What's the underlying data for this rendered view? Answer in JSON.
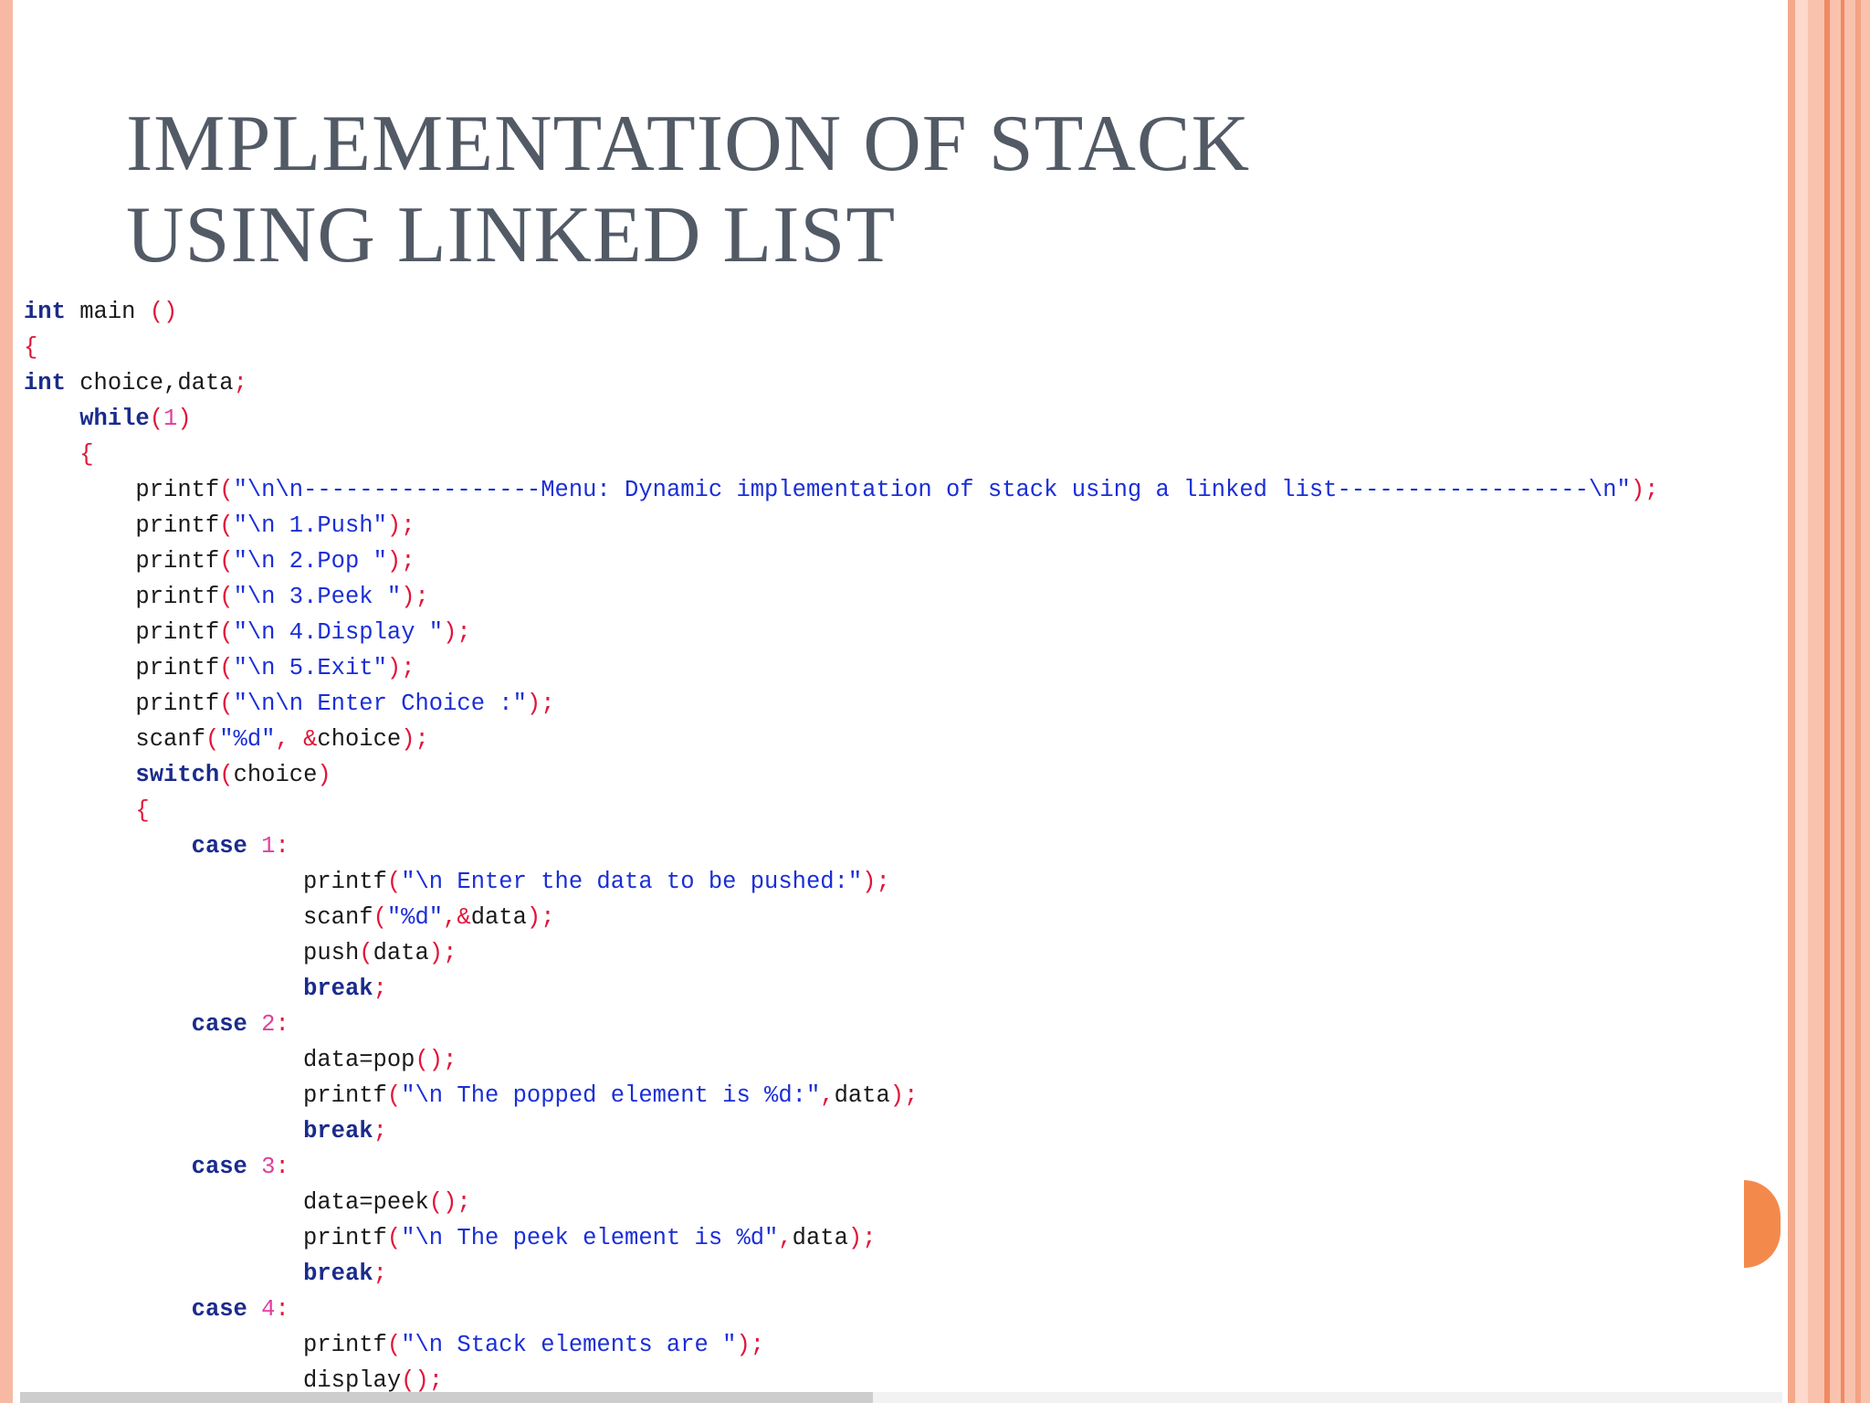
{
  "slide": {
    "title": "IMPLEMENTATION OF STACK\nUSING LINKED LIST"
  },
  "code": {
    "lines": [
      [
        {
          "t": "kw",
          "v": "int"
        },
        {
          "t": "idt",
          "v": " main "
        },
        {
          "t": "pun",
          "v": "()"
        }
      ],
      [
        {
          "t": "pun",
          "v": "{"
        }
      ],
      [
        {
          "t": "kw",
          "v": "int"
        },
        {
          "t": "idt",
          "v": " choice,data"
        },
        {
          "t": "pun",
          "v": ";"
        }
      ],
      [
        {
          "t": "idt",
          "v": "    "
        },
        {
          "t": "kw",
          "v": "while"
        },
        {
          "t": "pun",
          "v": "("
        },
        {
          "t": "num",
          "v": "1"
        },
        {
          "t": "pun",
          "v": ")"
        }
      ],
      [
        {
          "t": "idt",
          "v": "    "
        },
        {
          "t": "pun",
          "v": "{"
        }
      ],
      [
        {
          "t": "idt",
          "v": "        printf"
        },
        {
          "t": "pun",
          "v": "("
        },
        {
          "t": "str",
          "v": "\"\\n\\n-----------------Menu: Dynamic implementation of stack using a linked list------------------\\n\""
        },
        {
          "t": "pun",
          "v": ");"
        }
      ],
      [
        {
          "t": "idt",
          "v": "        printf"
        },
        {
          "t": "pun",
          "v": "("
        },
        {
          "t": "str",
          "v": "\"\\n 1.Push\""
        },
        {
          "t": "pun",
          "v": ");"
        }
      ],
      [
        {
          "t": "idt",
          "v": "        printf"
        },
        {
          "t": "pun",
          "v": "("
        },
        {
          "t": "str",
          "v": "\"\\n 2.Pop \""
        },
        {
          "t": "pun",
          "v": ");"
        }
      ],
      [
        {
          "t": "idt",
          "v": "        printf"
        },
        {
          "t": "pun",
          "v": "("
        },
        {
          "t": "str",
          "v": "\"\\n 3.Peek \""
        },
        {
          "t": "pun",
          "v": ");"
        }
      ],
      [
        {
          "t": "idt",
          "v": "        printf"
        },
        {
          "t": "pun",
          "v": "("
        },
        {
          "t": "str",
          "v": "\"\\n 4.Display \""
        },
        {
          "t": "pun",
          "v": ");"
        }
      ],
      [
        {
          "t": "idt",
          "v": "        printf"
        },
        {
          "t": "pun",
          "v": "("
        },
        {
          "t": "str",
          "v": "\"\\n 5.Exit\""
        },
        {
          "t": "pun",
          "v": ");"
        }
      ],
      [
        {
          "t": "idt",
          "v": "        printf"
        },
        {
          "t": "pun",
          "v": "("
        },
        {
          "t": "str",
          "v": "\"\\n\\n Enter Choice :\""
        },
        {
          "t": "pun",
          "v": ");"
        }
      ],
      [
        {
          "t": "idt",
          "v": "        scanf"
        },
        {
          "t": "pun",
          "v": "("
        },
        {
          "t": "str",
          "v": "\"%d\""
        },
        {
          "t": "pun",
          "v": ", &"
        },
        {
          "t": "idt",
          "v": "choice"
        },
        {
          "t": "pun",
          "v": ");"
        }
      ],
      [
        {
          "t": "idt",
          "v": "        "
        },
        {
          "t": "kw",
          "v": "switch"
        },
        {
          "t": "pun",
          "v": "("
        },
        {
          "t": "idt",
          "v": "choice"
        },
        {
          "t": "pun",
          "v": ")"
        }
      ],
      [
        {
          "t": "idt",
          "v": "        "
        },
        {
          "t": "pun",
          "v": "{"
        }
      ],
      [
        {
          "t": "idt",
          "v": "            "
        },
        {
          "t": "kw",
          "v": "case"
        },
        {
          "t": "idt",
          "v": " "
        },
        {
          "t": "num",
          "v": "1"
        },
        {
          "t": "pun",
          "v": ":"
        }
      ],
      [
        {
          "t": "idt",
          "v": "                    printf"
        },
        {
          "t": "pun",
          "v": "("
        },
        {
          "t": "str",
          "v": "\"\\n Enter the data to be pushed:\""
        },
        {
          "t": "pun",
          "v": ");"
        }
      ],
      [
        {
          "t": "idt",
          "v": "                    scanf"
        },
        {
          "t": "pun",
          "v": "("
        },
        {
          "t": "str",
          "v": "\"%d\""
        },
        {
          "t": "pun",
          "v": ",&"
        },
        {
          "t": "idt",
          "v": "data"
        },
        {
          "t": "pun",
          "v": ");"
        }
      ],
      [
        {
          "t": "idt",
          "v": "                    push"
        },
        {
          "t": "pun",
          "v": "("
        },
        {
          "t": "idt",
          "v": "data"
        },
        {
          "t": "pun",
          "v": ");"
        }
      ],
      [
        {
          "t": "idt",
          "v": "                    "
        },
        {
          "t": "kw",
          "v": "break"
        },
        {
          "t": "pun",
          "v": ";"
        }
      ],
      [
        {
          "t": "idt",
          "v": "            "
        },
        {
          "t": "kw",
          "v": "case"
        },
        {
          "t": "idt",
          "v": " "
        },
        {
          "t": "num",
          "v": "2"
        },
        {
          "t": "pun",
          "v": ":"
        }
      ],
      [
        {
          "t": "idt",
          "v": "                    data=pop"
        },
        {
          "t": "pun",
          "v": "();"
        }
      ],
      [
        {
          "t": "idt",
          "v": "                    printf"
        },
        {
          "t": "pun",
          "v": "("
        },
        {
          "t": "str",
          "v": "\"\\n The popped element is %d:\""
        },
        {
          "t": "pun",
          "v": ","
        },
        {
          "t": "idt",
          "v": "data"
        },
        {
          "t": "pun",
          "v": ");"
        }
      ],
      [
        {
          "t": "idt",
          "v": "                    "
        },
        {
          "t": "kw",
          "v": "break"
        },
        {
          "t": "pun",
          "v": ";"
        }
      ],
      [
        {
          "t": "idt",
          "v": "            "
        },
        {
          "t": "kw",
          "v": "case"
        },
        {
          "t": "idt",
          "v": " "
        },
        {
          "t": "num",
          "v": "3"
        },
        {
          "t": "pun",
          "v": ":"
        }
      ],
      [
        {
          "t": "idt",
          "v": "                    data=peek"
        },
        {
          "t": "pun",
          "v": "();"
        }
      ],
      [
        {
          "t": "idt",
          "v": "                    printf"
        },
        {
          "t": "pun",
          "v": "("
        },
        {
          "t": "str",
          "v": "\"\\n The peek element is %d\""
        },
        {
          "t": "pun",
          "v": ","
        },
        {
          "t": "idt",
          "v": "data"
        },
        {
          "t": "pun",
          "v": ");"
        }
      ],
      [
        {
          "t": "idt",
          "v": "                    "
        },
        {
          "t": "kw",
          "v": "break"
        },
        {
          "t": "pun",
          "v": ";"
        }
      ],
      [
        {
          "t": "idt",
          "v": "            "
        },
        {
          "t": "kw",
          "v": "case"
        },
        {
          "t": "idt",
          "v": " "
        },
        {
          "t": "num",
          "v": "4"
        },
        {
          "t": "pun",
          "v": ":"
        }
      ],
      [
        {
          "t": "idt",
          "v": "                    printf"
        },
        {
          "t": "pun",
          "v": "("
        },
        {
          "t": "str",
          "v": "\"\\n Stack elements are \""
        },
        {
          "t": "pun",
          "v": ");"
        }
      ],
      [
        {
          "t": "idt",
          "v": "                    display"
        },
        {
          "t": "pun",
          "v": "();"
        }
      ]
    ]
  }
}
